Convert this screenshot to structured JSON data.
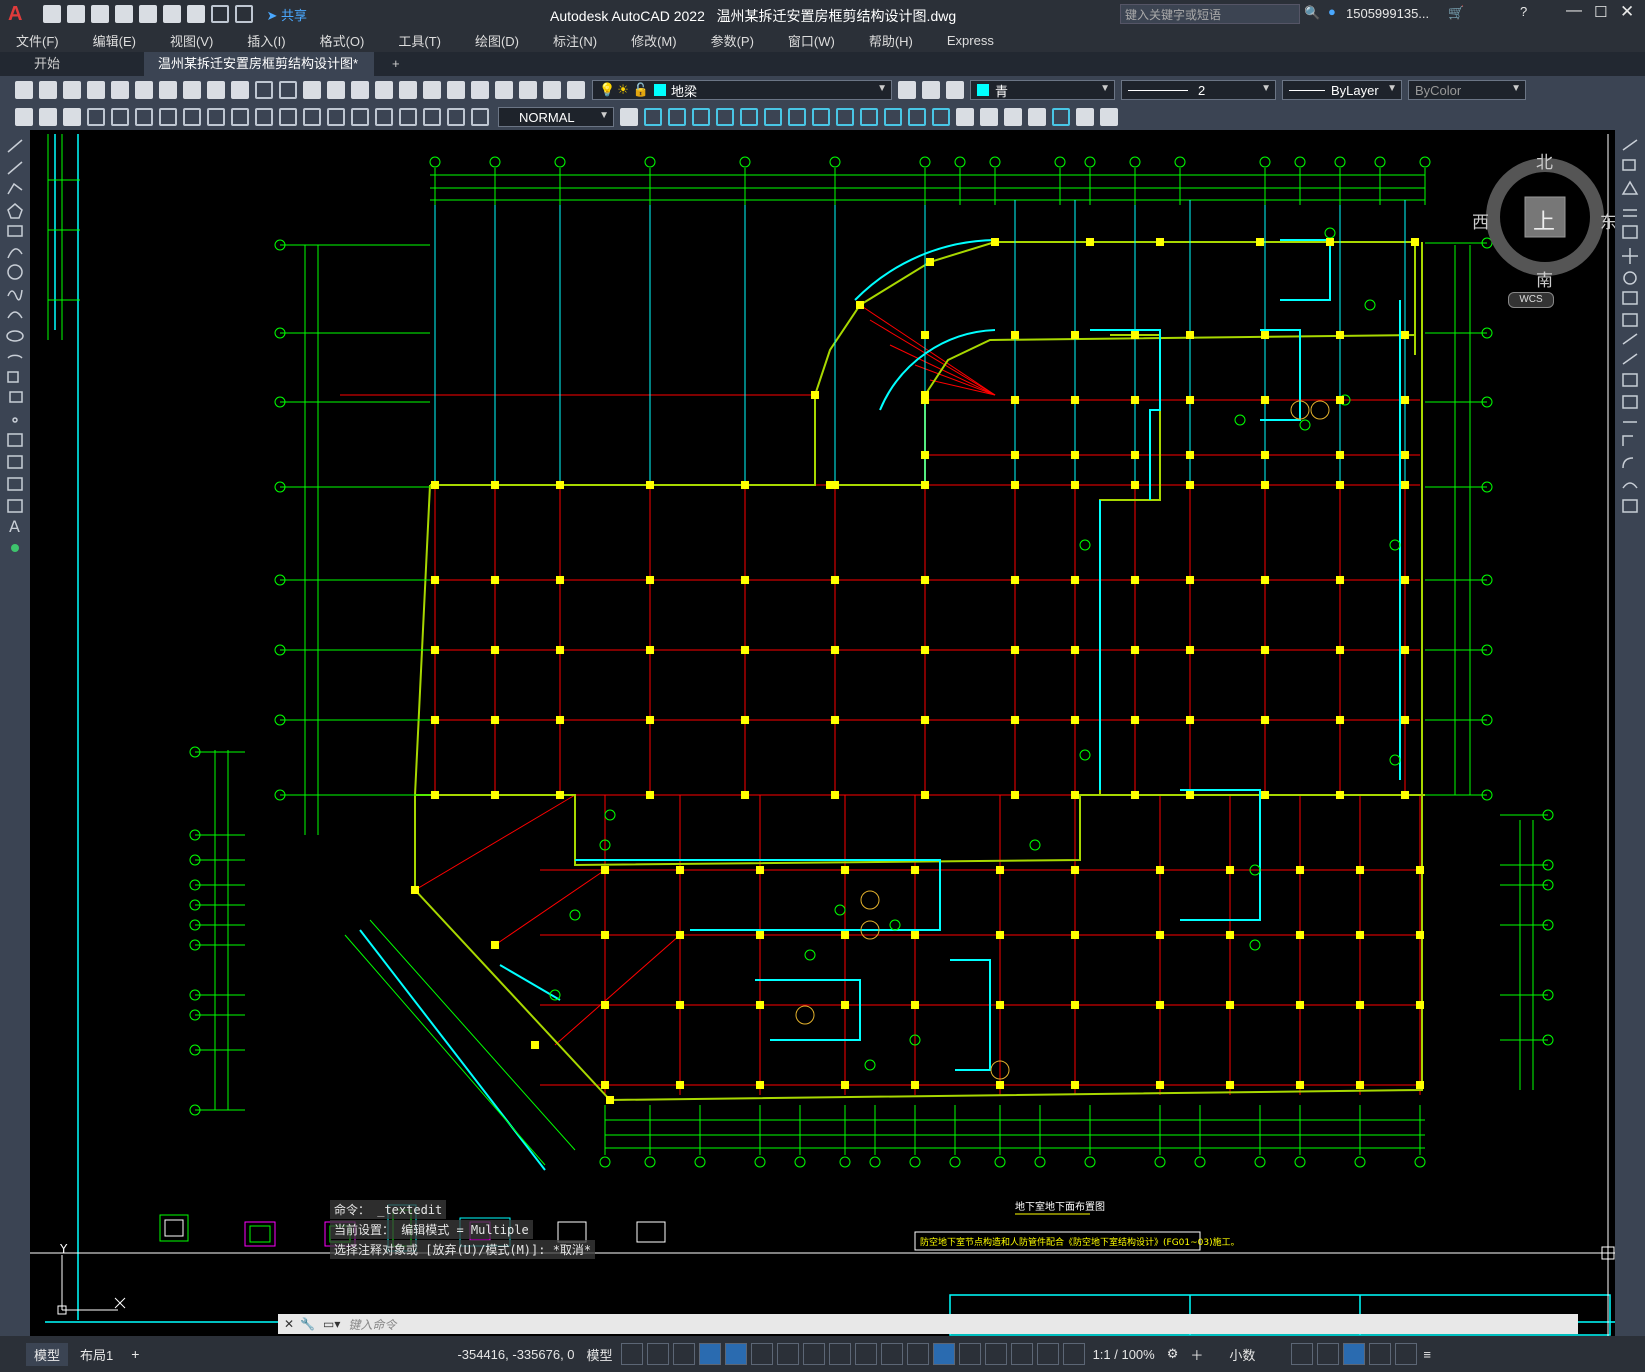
{
  "app": {
    "product_title": "Autodesk AutoCAD 2022",
    "file_title": "温州某拆迁安置房框剪结构设计图.dwg",
    "share_label": "共享",
    "search_placeholder": "键入关键字或短语",
    "user": "1505999135...",
    "logo_letter": "A"
  },
  "menu": [
    "文件(F)",
    "编辑(E)",
    "视图(V)",
    "插入(I)",
    "格式(O)",
    "工具(T)",
    "绘图(D)",
    "标注(N)",
    "修改(M)",
    "参数(P)",
    "窗口(W)",
    "帮助(H)",
    "Express"
  ],
  "tabs": {
    "start": "开始",
    "drawing": "温州某拆迁安置房框剪结构设计图*",
    "add": "+"
  },
  "toolbar": {
    "layer": "地梁",
    "color": "青",
    "linetype_value": "2",
    "lineweight": "ByLayer",
    "plotstyle": "ByColor",
    "textstyle": "NORMAL"
  },
  "viewcube": {
    "north": "北",
    "south": "南",
    "east": "东",
    "west": "西",
    "top": "上",
    "wcs": "WCS"
  },
  "drawing": {
    "title": "地下室地下面布置图",
    "note": "防空地下室节点构造和人防管件配合《防空地下室结构设计》(FG01~03)施工。",
    "axis_y": "Y"
  },
  "command": {
    "history": [
      "命令： _textedit",
      "当前设置： 编辑模式 = Multiple",
      "选择注释对象或 [放弃(U)/模式(M)]: *取消*"
    ],
    "placeholder": "键入命令"
  },
  "layout_tabs": [
    "模型",
    "布局1",
    "+"
  ],
  "status": {
    "coords": "-354416, -335676, 0",
    "model": "模型",
    "scale": "1:1 / 100%",
    "units": "小数"
  },
  "colors": {
    "beam": "#ff0000",
    "wall": "#00ffff",
    "dim": "#00ff00",
    "column": "#ffff00"
  }
}
